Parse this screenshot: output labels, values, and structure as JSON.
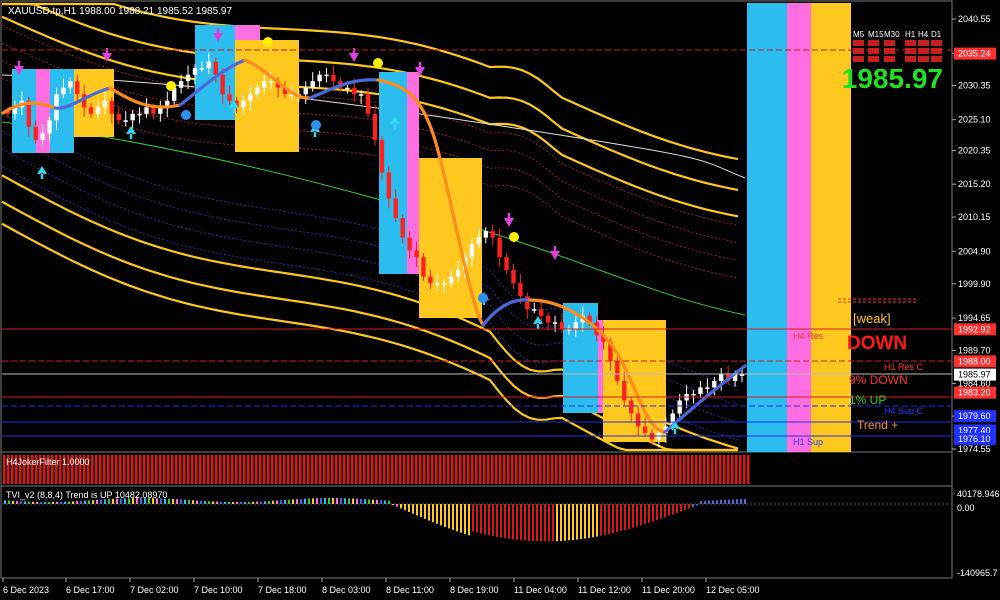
{
  "main_panel": {
    "header": "XAUUSD.tp,H1  1988.00 1988.21 1985.52 1985.97",
    "current_price": "1985.97",
    "timeframes": [
      "M5",
      "M15",
      "M30",
      "H1",
      "H4",
      "D1"
    ],
    "signal_text": {
      "weak": "[weak]",
      "direction": "DOWN",
      "down_pct": "9%  DOWN",
      "up_pct": "1%      UP",
      "trend": "Trend   +",
      "h4_res": "H4 Res",
      "h1_res_c": "H1 Res C",
      "h4_sup_c": "H4 Sup C",
      "h1_sup": "H1 Sup"
    }
  },
  "price_axis": {
    "ticks": [
      "2040.55",
      "2035.30",
      "2030.35",
      "2025.10",
      "2020.35",
      "2015.20",
      "2010.15",
      "2004.90",
      "1999.90",
      "1994.65",
      "1989.70",
      "1984.60",
      "1979.60",
      "1974.55"
    ],
    "labels": [
      {
        "text": "2035.24",
        "color": "#ff3030"
      },
      {
        "text": "1992.92",
        "color": "#ff3030"
      },
      {
        "text": "1988.00",
        "color": "#ff3030"
      },
      {
        "text": "1985.97",
        "color": "#ffffff"
      },
      {
        "text": "1983.20",
        "color": "#ff3030"
      },
      {
        "text": "1979.60",
        "color": "#2030ff"
      },
      {
        "text": "1977.40",
        "color": "#2030ff"
      },
      {
        "text": "1976.10",
        "color": "#2030ff"
      }
    ]
  },
  "sub_panels": {
    "filter": {
      "title": "H4JokerFilter 1.0000"
    },
    "tvi": {
      "title": "TVI_v2 (8,8,4) Trend is UP 10482.08970",
      "axis_top": "40178.946",
      "axis_zero": "0.00",
      "axis_bottom": "-140965.7"
    }
  },
  "time_axis": {
    "labels": [
      "6 Dec 2023",
      "6 Dec 17:00",
      "7 Dec 02:00",
      "7 Dec 10:00",
      "7 Dec 18:00",
      "8 Dec 03:00",
      "8 Dec 11:00",
      "8 Dec 19:00",
      "11 Dec 04:00",
      "11 Dec 12:00",
      "11 Dec 20:00",
      "12 Dec 05:00"
    ]
  },
  "chart_data": {
    "type": "candlestick",
    "symbol": "XAUUSD.tp",
    "timeframe": "H1",
    "ylim": [
      1974.55,
      2040.55
    ],
    "ohlc_last": {
      "open": 1988.0,
      "high": 1988.21,
      "low": 1985.52,
      "close": 1985.97
    },
    "closes": [
      2026,
      2027,
      2028,
      2024,
      2022,
      2023,
      2025,
      2029,
      2030,
      2031,
      2029,
      2027,
      2026,
      2027,
      2028,
      2026,
      2025,
      2025,
      2026,
      2026,
      2027,
      2026,
      2027,
      2028,
      2030,
      2031,
      2032,
      2033,
      2033,
      2034,
      2032,
      2029,
      2028,
      2027,
      2028,
      2029,
      2030,
      2031,
      2031,
      2030,
      2029,
      2029,
      2029,
      2030,
      2031,
      2032,
      2032,
      2031,
      2030,
      2030,
      2029,
      2029,
      2026,
      2022,
      2017,
      2013,
      2010,
      2007,
      2005,
      2004,
      2001,
      2000,
      2000,
      2000,
      2001,
      2002,
      2004,
      2006,
      2007,
      2008,
      2007,
      2004,
      2002,
      2000,
      1998,
      1996,
      1996,
      1995,
      1994,
      1994,
      1993,
      1993,
      1994,
      1995,
      1994,
      1992,
      1991,
      1988,
      1985,
      1982,
      1980,
      1978,
      1977,
      1976,
      1977,
      1978,
      1980,
      1982,
      1983,
      1983,
      1984,
      1984,
      1985,
      1986,
      1985,
      1986,
      1986
    ]
  },
  "colors": {
    "bg": "#000000",
    "bull": "#ffffff",
    "bear": "#ff2020",
    "blue": "#2bbcf0",
    "pink": "#ff6ee0",
    "yellow": "#ffc81e",
    "orange": "#ff8c1a",
    "hma_blue": "#4a6ad8"
  }
}
